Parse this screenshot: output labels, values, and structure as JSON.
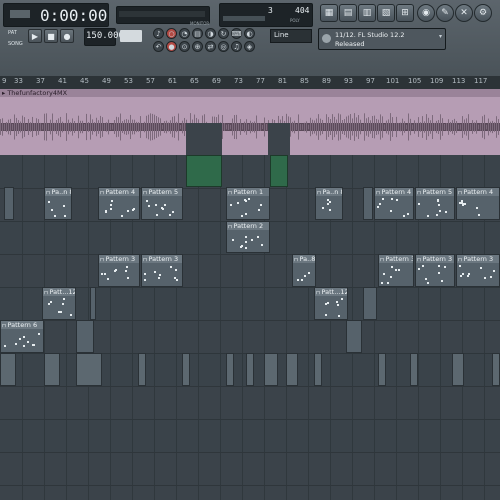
{
  "toolbar": {
    "time_display": "0:00:00",
    "tempo": "150.000",
    "cpu": "3",
    "memory": "404",
    "snap_mode": "Line",
    "hint_title": "11/12. FL Studio 12.2",
    "hint_sub": "Released",
    "pat_label": "PAT",
    "song_label": "SONG",
    "monitor_label": "MONITOR",
    "poly_label": "POLY"
  },
  "ruler": {
    "ticks": [
      "9",
      "33",
      "37",
      "41",
      "45",
      "49",
      "53",
      "57",
      "61",
      "65",
      "69",
      "73",
      "77",
      "81",
      "85",
      "89",
      "93",
      "97",
      "101",
      "105",
      "109",
      "113",
      "117"
    ]
  },
  "audio": {
    "track_name": "▸ Thefunfactory4MX"
  },
  "clips": {
    "pa_n8_a": "Pa..n 8",
    "pattern4_a": "Pattern 4",
    "pattern5_a": "Pattern 5",
    "pattern1": "Pattern 1",
    "pa_n8_b": "Pa..n 8",
    "pattern4_b": "Pattern 4",
    "pattern5_b": "Pattern 5",
    "pattern4_c": "Pattern 4",
    "pattern2": "Pattern 2",
    "pattern3_a": "Pattern 3",
    "pattern3_b": "Pattern 3",
    "pa_8": "Pa..8",
    "pattern3_c": "Pattern 3",
    "pattern3_d": "Pattern 3",
    "pattern3_e": "Pattern 3",
    "patt12_a": "Patt...12",
    "patt12_b": "Patt...12",
    "pattern6": "Pattern 6"
  }
}
